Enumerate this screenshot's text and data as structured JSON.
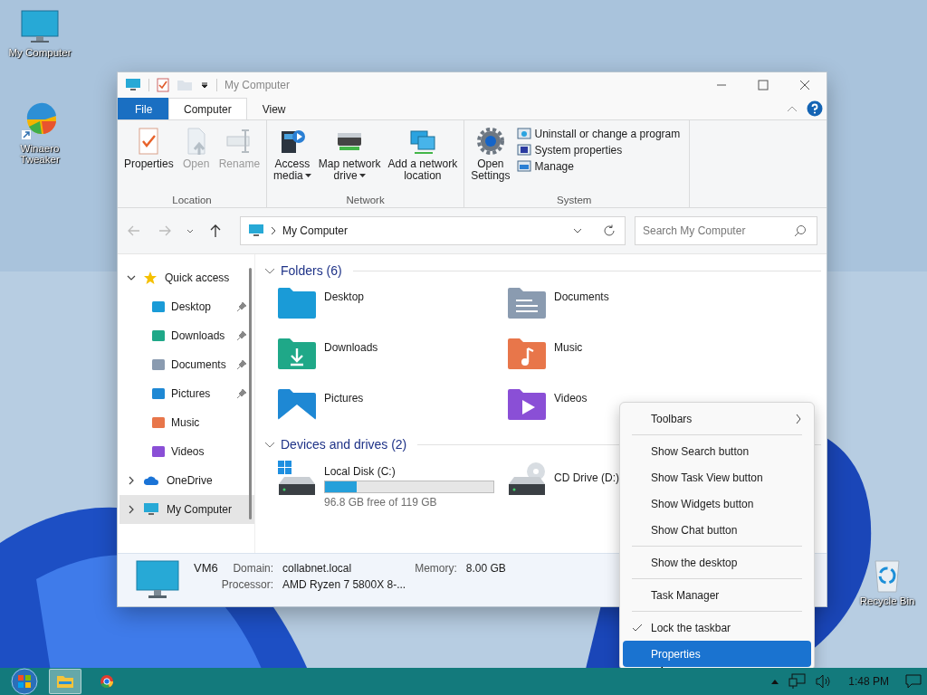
{
  "desktop_icons": [
    {
      "label": "My Computer",
      "kind": "computer"
    },
    {
      "label": "Winaero Tweaker",
      "kind": "app"
    },
    {
      "label": "Recycle Bin",
      "kind": "recycle"
    }
  ],
  "window": {
    "title": "My Computer",
    "ribbon_tabs": [
      {
        "label": "File",
        "kind": "file",
        "selected": false
      },
      {
        "label": "Computer",
        "kind": "tab",
        "selected": true
      },
      {
        "label": "View",
        "kind": "tab",
        "selected": false
      }
    ],
    "ribbon_groups": [
      {
        "label": "Location",
        "commands": [
          {
            "label": "Properties",
            "kind": "properties",
            "disabled": false,
            "dropdown": false
          },
          {
            "label": "Open",
            "kind": "open",
            "disabled": true,
            "dropdown": false
          },
          {
            "label": "Rename",
            "kind": "rename",
            "disabled": true,
            "dropdown": false
          }
        ]
      },
      {
        "label": "Network",
        "commands": [
          {
            "label": "Access\nmedia",
            "kind": "media",
            "disabled": false,
            "dropdown": true
          },
          {
            "label": "Map network\ndrive",
            "kind": "netdrive",
            "disabled": false,
            "dropdown": true
          },
          {
            "label": "Add a network\nlocation",
            "kind": "netloc",
            "disabled": false,
            "dropdown": false
          }
        ]
      },
      {
        "label": "System",
        "commands": [
          {
            "label": "Open\nSettings",
            "kind": "settings",
            "disabled": false,
            "dropdown": false
          }
        ],
        "small_commands": [
          {
            "label": "Uninstall or change a program",
            "kind": "uninstall"
          },
          {
            "label": "System properties",
            "kind": "sysprops"
          },
          {
            "label": "Manage",
            "kind": "manage"
          }
        ]
      }
    ],
    "nav_buttons": [
      {
        "kind": "back",
        "disabled": true
      },
      {
        "kind": "forward",
        "disabled": true
      },
      {
        "kind": "recent",
        "disabled": false
      },
      {
        "kind": "up",
        "disabled": false
      }
    ],
    "address": "My Computer",
    "search": {
      "placeholder": "Search My Computer"
    },
    "tree": [
      {
        "label": "Quick access",
        "kind": "star",
        "expanded": true,
        "selected": false,
        "children": [
          {
            "label": "Desktop",
            "kind": "desktop",
            "pinned": true
          },
          {
            "label": "Downloads",
            "kind": "downloads",
            "pinned": true
          },
          {
            "label": "Documents",
            "kind": "documents",
            "pinned": true
          },
          {
            "label": "Pictures",
            "kind": "pictures",
            "pinned": true
          },
          {
            "label": "Music",
            "kind": "music",
            "pinned": false
          },
          {
            "label": "Videos",
            "kind": "videos",
            "pinned": false
          }
        ]
      },
      {
        "label": "OneDrive",
        "kind": "cloud",
        "expanded": false,
        "selected": false
      },
      {
        "label": "My Computer",
        "kind": "computer",
        "expanded": false,
        "selected": true
      }
    ],
    "sections": [
      {
        "title": "Folders (6)",
        "kind": "folders",
        "expanded": true,
        "items": [
          {
            "label": "Desktop",
            "kind": "desktop"
          },
          {
            "label": "Documents",
            "kind": "documents"
          },
          {
            "label": "Downloads",
            "kind": "downloads"
          },
          {
            "label": "Music",
            "kind": "music"
          },
          {
            "label": "Pictures",
            "kind": "pictures"
          },
          {
            "label": "Videos",
            "kind": "videos"
          }
        ]
      },
      {
        "title": "Devices and drives (2)",
        "kind": "drives",
        "expanded": true,
        "items": [
          {
            "label": "Local Disk (C:)",
            "kind": "disk",
            "level": 0.19,
            "free": "96.8 GB free of 119 GB"
          },
          {
            "label": "CD Drive (D:)",
            "kind": "cd"
          }
        ]
      }
    ],
    "details": {
      "name": "VM6",
      "fields": [
        {
          "label": "Domain:",
          "value": "collabnet.local"
        },
        {
          "label": "Memory:",
          "value": "8.00 GB"
        },
        {
          "label": "Processor:",
          "value": "AMD Ryzen 7 5800X 8-..."
        }
      ]
    }
  },
  "context_menu": {
    "groups": [
      {
        "items": [
          {
            "label": "Toolbars",
            "kind": "submenu",
            "checked": false,
            "selected": false
          }
        ]
      },
      {
        "items": [
          {
            "label": "Show Search button",
            "kind": "command",
            "checked": false,
            "selected": false
          },
          {
            "label": "Show Task View button",
            "kind": "command",
            "checked": false,
            "selected": false
          },
          {
            "label": "Show Widgets button",
            "kind": "command",
            "checked": false,
            "selected": false
          },
          {
            "label": "Show Chat button",
            "kind": "command",
            "checked": false,
            "selected": false
          }
        ]
      },
      {
        "items": [
          {
            "label": "Show the desktop",
            "kind": "command",
            "checked": false,
            "selected": false
          }
        ]
      },
      {
        "items": [
          {
            "label": "Task Manager",
            "kind": "command",
            "checked": false,
            "selected": false
          }
        ]
      },
      {
        "items": [
          {
            "label": "Lock the taskbar",
            "kind": "command",
            "checked": true,
            "selected": false
          },
          {
            "label": "Properties",
            "kind": "command",
            "checked": false,
            "selected": true
          }
        ]
      }
    ]
  },
  "taskbar": {
    "apps": [
      {
        "kind": "explorer",
        "active": true
      },
      {
        "kind": "browser",
        "active": false
      }
    ],
    "clock": "1:48 PM"
  }
}
